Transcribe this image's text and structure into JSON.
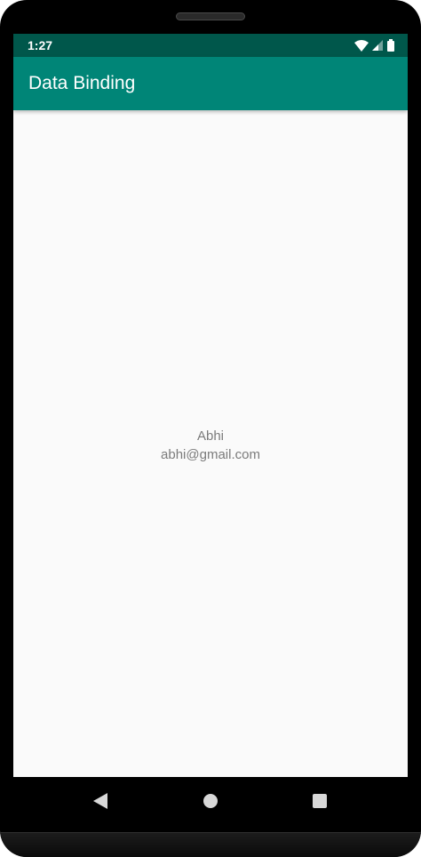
{
  "status_bar": {
    "time": "1:27",
    "icons": [
      "wifi-icon",
      "cell-signal-icon",
      "battery-icon"
    ],
    "color": "#00574b"
  },
  "app_bar": {
    "title": "Data Binding",
    "color": "#008577"
  },
  "user": {
    "name": "Abhi",
    "email": "abhi@gmail.com"
  },
  "nav_bar": {
    "buttons": [
      "back-icon",
      "home-icon",
      "recents-icon"
    ]
  }
}
